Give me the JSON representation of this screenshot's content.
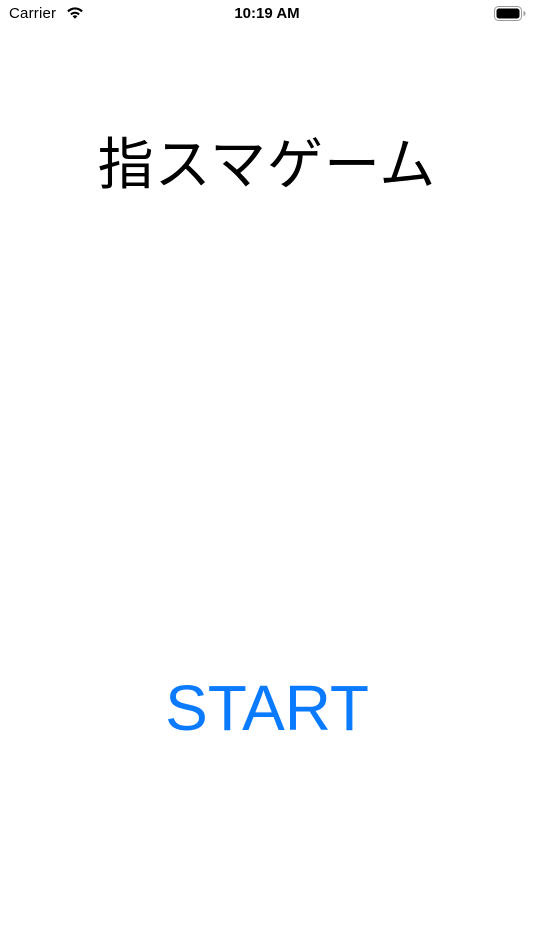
{
  "status_bar": {
    "carrier": "Carrier",
    "time": "10:19 AM",
    "wifi_icon": "wifi-icon",
    "battery_icon": "battery-icon"
  },
  "main": {
    "title": "指スマゲーム",
    "start_button_label": "START"
  },
  "colors": {
    "background": "#ffffff",
    "text": "#000000",
    "accent": "#0a7aff"
  }
}
